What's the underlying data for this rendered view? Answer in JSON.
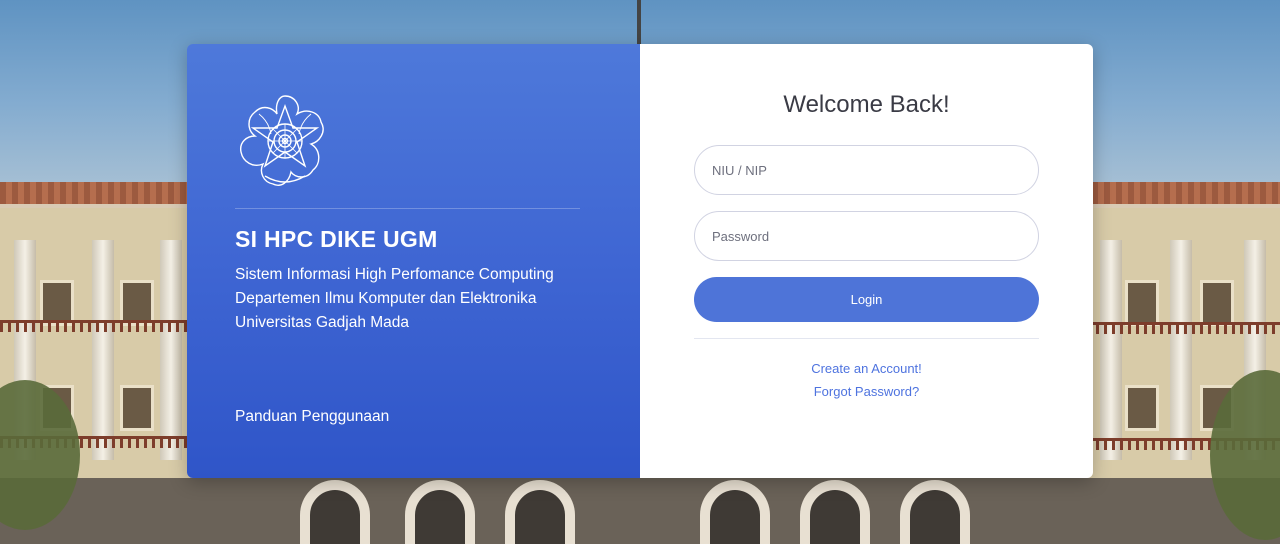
{
  "brand": {
    "logo_icon": "ugm-emblem-icon",
    "title": "SI HPC DIKE UGM",
    "description_lines": [
      "Sistem Informasi High Perfomance Computing",
      "Departemen Ilmu Komputer dan Elektronika",
      "Universitas Gadjah Mada"
    ],
    "guide_link": "Panduan Penggunaan"
  },
  "login": {
    "heading": "Welcome Back!",
    "username_placeholder": "NIU / NIP",
    "username_value": "",
    "password_placeholder": "Password",
    "password_value": "",
    "submit_label": "Login",
    "create_account_link": "Create an Account!",
    "forgot_password_link": "Forgot Password?"
  },
  "colors": {
    "panel_blue": "#4e74d8",
    "link_blue": "#4e73df",
    "heading_text": "#3a3b45"
  }
}
